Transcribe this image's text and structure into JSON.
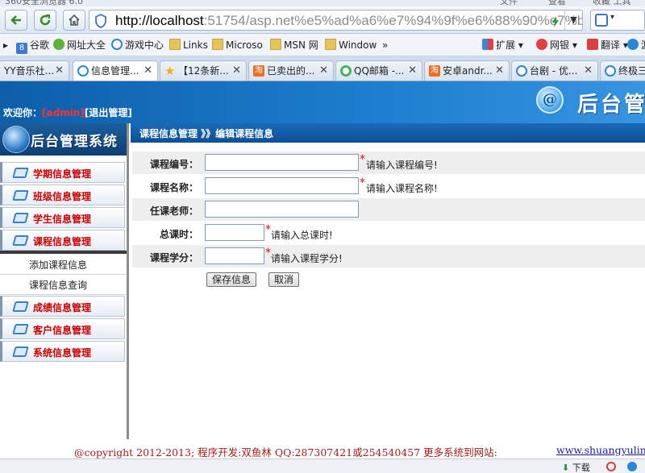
{
  "titlebar": {
    "left_text": "360安全浏览器 6.0",
    "menu1": "文件",
    "menu2": "查看",
    "menu3": "收藏 工具"
  },
  "browser": {
    "url_host": "http://localhost",
    "url_rest": ":51754/asp.net%e5%ad%a6%e7%94%9f%e6%88%90%e7%bb%a9"
  },
  "favorites": [
    {
      "label": "谷歌",
      "icon": "google-8-icon"
    },
    {
      "label": "网址大全",
      "icon": "green-globe-icon"
    },
    {
      "label": "游戏中心",
      "icon": "ie-page-icon"
    },
    {
      "label": "Links",
      "icon": "folder-icon"
    },
    {
      "label": "Microso",
      "icon": "folder-icon"
    },
    {
      "label": "MSN 网",
      "icon": "folder-icon"
    },
    {
      "label": "Window",
      "icon": "folder-icon"
    }
  ],
  "fav_more": "»",
  "fav_right": [
    {
      "label": "扩展",
      "icon": "extensions-icon"
    },
    {
      "label": "网银",
      "icon": "bank-icon"
    },
    {
      "label": "翻译",
      "icon": "translate-icon"
    },
    {
      "label": "游戏",
      "icon": "game-icon"
    }
  ],
  "tabs": [
    {
      "label": "YY音乐社...",
      "icon": "none",
      "active": false
    },
    {
      "label": "信息管理...",
      "icon": "ie-page-icon",
      "active": true
    },
    {
      "label": "【12条新...",
      "icon": "star-icon",
      "active": false
    },
    {
      "label": "已卖出的...",
      "icon": "taobao-icon",
      "active": false
    },
    {
      "label": "QQ邮箱 -...",
      "icon": "qq-icon",
      "active": false
    },
    {
      "label": "安卓andr...",
      "icon": "taobao-icon",
      "active": false
    },
    {
      "label": "台剧 - 优...",
      "icon": "ie-page-icon",
      "active": false
    },
    {
      "label": "终极三...",
      "icon": "ie-page-icon",
      "active": false
    }
  ],
  "header": {
    "welcome_prefix": "欢迎你：",
    "username": "[admin]",
    "logout": "[退出管理]",
    "logo_glyph": "@",
    "title": "后台管理"
  },
  "sidebar": {
    "title": "后台管理系统",
    "groups": [
      "学期信息管理",
      "班级信息管理",
      "学生信息管理",
      "课程信息管理",
      "成绩信息管理",
      "客户信息管理",
      "系统信息管理"
    ],
    "sub_items": [
      "添加课程信息",
      "课程信息查询"
    ]
  },
  "main": {
    "breadcrumb": "课程信息管理 》》编辑课程信息",
    "form": {
      "rows": [
        {
          "label": "课程编号：",
          "value": "",
          "required": true,
          "hint": "请输入课程编号!"
        },
        {
          "label": "课程名称：",
          "value": "",
          "required": true,
          "hint": "请输入课程名称!"
        },
        {
          "label": "任课老师：",
          "value": "",
          "required": false,
          "hint": ""
        },
        {
          "label": "总课时：",
          "value": "",
          "required": true,
          "hint": "请输入总课时!"
        },
        {
          "label": "课程学分：",
          "value": "",
          "required": true,
          "hint": "请输入课程学分!"
        }
      ],
      "required_mark": "*",
      "save_label": "保存信息",
      "cancel_label": "取消"
    }
  },
  "footer": {
    "copyright": "@copyright 2012-2013; 程序开发:双鱼林 QQ:287307421或254540457 更多系统到网站:",
    "link": "www.shuangyulin"
  },
  "statusbar": {
    "download": "下载"
  }
}
